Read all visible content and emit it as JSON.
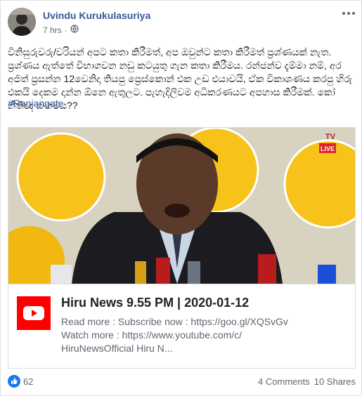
{
  "post": {
    "author": "Uvindu Kurukulasuriya",
    "time": "7 hrs",
    "separator": "·",
    "text": "විනිසුරුවරු/වරියන් අපට කතා කිරීමත්, අප ඔවුන්ට කතා කිරීමත් ප්‍රශ්ණයක් නැත. ප්‍රශ්ණය ඇත්තේ විභාගවන නඩු කටයුතු ගැන කතා කිරීමය. රන්ජන්ව දැම්මා නම්, අර අජිත් ප්‍රසන්න 12වෙනිදා තියපු ප්‍රෙස්කොන් එක උඩ එයාවයි, ඒක විකාශණය කරපු හිරු එකයි දෙකම දාන්න ඕනෙ ඇතුලට. පැහැදිලිවම අධිකරණයට අපහාස කිරීමක්. කෝ නීතිඥ සංගමය??",
    "hashtag": "#Ranjangate"
  },
  "link": {
    "title": "Hiru News 9.55 PM | 2020-01-12",
    "desc_line1": "Read more : Subscribe now : https://goo.gl/XQSvGv",
    "desc_line2": "Watch more : https://www.youtube.com/c/",
    "desc_line3": "HiruNewsOfficial Hiru N...",
    "thumb_live": "LIVE",
    "thumb_tv": "TV"
  },
  "footer": {
    "likes": "62",
    "comments": "4 Comments",
    "shares": "10 Shares"
  },
  "colors": {
    "link_blue": "#385898",
    "like_blue": "#1877f2",
    "youtube_red": "#ff0000",
    "banner_yellow": "#f7c21a"
  },
  "icons": [
    "globe-icon",
    "more-icon",
    "youtube-icon",
    "like-icon"
  ]
}
